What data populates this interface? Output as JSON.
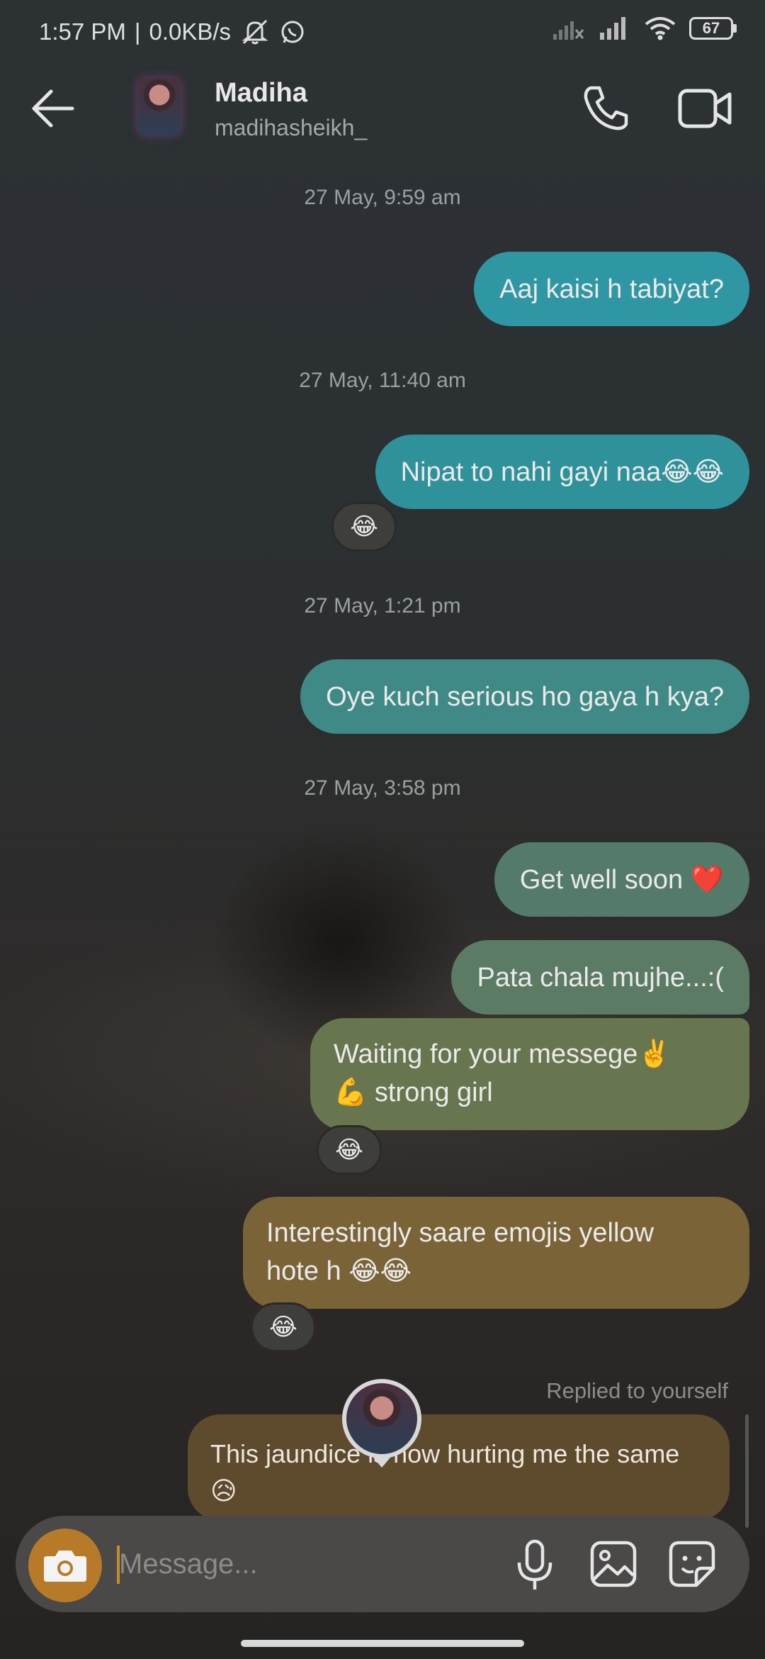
{
  "status_bar": {
    "time": "1:57 PM",
    "separator": "|",
    "net_speed": "0.0KB/s",
    "battery": "67",
    "icons": [
      "mute-icon",
      "whatsapp-icon",
      "signal-icon",
      "signal-icon",
      "wifi-icon",
      "battery-icon"
    ]
  },
  "header": {
    "name": "Madiha",
    "handle": "madihasheikh_",
    "icons": [
      "back-arrow-icon",
      "phone-icon",
      "video-camera-icon"
    ]
  },
  "messages": [
    {
      "timestamp": "27 May, 9:59 am"
    },
    {
      "text": "Aaj kaisi h tabiyat?",
      "color": "#2f96a3"
    },
    {
      "timestamp": "27 May, 11:40 am"
    },
    {
      "text": "Nipat to nahi gayi naa😂😂",
      "color": "#2f929a",
      "reaction": "😂"
    },
    {
      "timestamp": "27 May, 1:21 pm"
    },
    {
      "text": "Oye kuch serious ho gaya h kya?",
      "color": "#3f8a86"
    },
    {
      "timestamp": "27 May, 3:58 pm"
    },
    {
      "text": "Get well soon ❤️",
      "color": "#547a6a"
    },
    {
      "text": "Pata chala mujhe...:(",
      "color": "#5b7b65"
    },
    {
      "text_line1": "Waiting for your messege✌️",
      "text_line2": "💪 strong girl",
      "color": "#687650",
      "reaction": "😂"
    },
    {
      "text_line1": "Interestingly saare emojis yellow",
      "text_line2": "hote h 😂😂",
      "color": "#7a6437",
      "reaction": "😂"
    }
  ],
  "reply": {
    "label": "Replied to yourself",
    "text_line1": "This jaundice is now hurting me the same",
    "text_line2": "😥"
  },
  "composer": {
    "placeholder": "Message...",
    "icons": [
      "camera-icon",
      "microphone-icon",
      "gallery-icon",
      "sticker-icon"
    ]
  }
}
